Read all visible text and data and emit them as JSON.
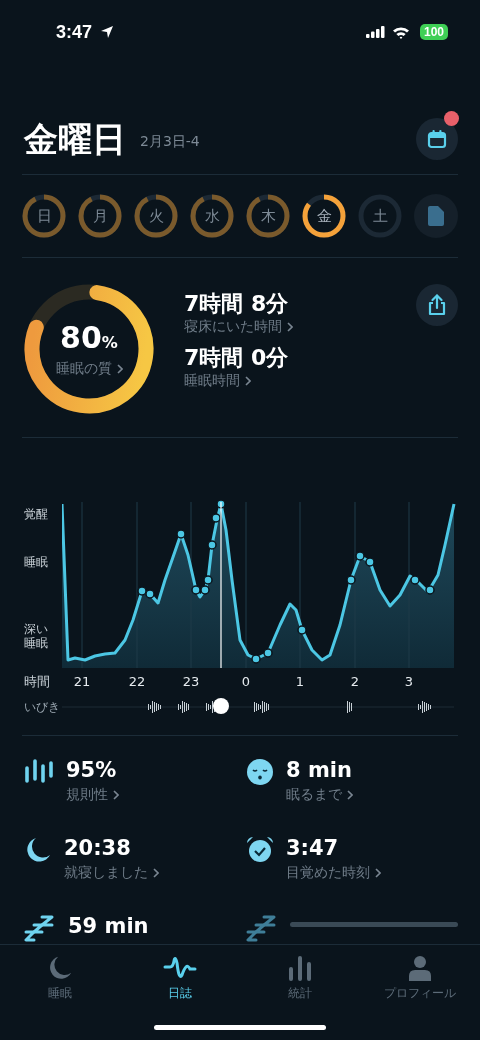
{
  "status_bar": {
    "time": "3:47",
    "battery": "100"
  },
  "header": {
    "title": "金曜日",
    "subtitle": "2月3日-4",
    "calendar_badge": true
  },
  "days": [
    {
      "label": "日",
      "recorded": true,
      "selected": false
    },
    {
      "label": "月",
      "recorded": true,
      "selected": false
    },
    {
      "label": "火",
      "recorded": true,
      "selected": false
    },
    {
      "label": "水",
      "recorded": true,
      "selected": false
    },
    {
      "label": "木",
      "recorded": true,
      "selected": false
    },
    {
      "label": "金",
      "recorded": true,
      "selected": true
    },
    {
      "label": "土",
      "recorded": false,
      "selected": false
    }
  ],
  "summary": {
    "quality": {
      "value": "80",
      "unit": "%",
      "label": "睡眠の質"
    },
    "metrics": [
      {
        "value": "7時間 8分",
        "label": "寝床にいた時間"
      },
      {
        "value": "7時間 0分",
        "label": "睡眠時間"
      }
    ]
  },
  "graph": {
    "y_labels": [
      "覚醒",
      "睡眠",
      "深い睡眠"
    ],
    "x_title": "時間",
    "hours": [
      "21",
      "22",
      "23",
      "0",
      "1",
      "2",
      "3"
    ],
    "snore_label": "いびき"
  },
  "stats": [
    {
      "kind": "bars",
      "value": "95%",
      "label": "規則性"
    },
    {
      "kind": "face",
      "value": "8 min",
      "label": "眠るまで"
    },
    {
      "kind": "moon",
      "value": "20:38",
      "label": "就寝しました"
    },
    {
      "kind": "alarm",
      "value": "3:47",
      "label": "目覚めた時刻"
    },
    {
      "kind": "zzz",
      "value": "59 min"
    },
    {
      "kind": "loading"
    }
  ],
  "tabs": [
    {
      "kind": "moon",
      "label": "睡眠",
      "selected": false
    },
    {
      "kind": "wave",
      "label": "日誌",
      "selected": true
    },
    {
      "kind": "bars",
      "label": "統計",
      "selected": false
    },
    {
      "kind": "person",
      "label": "プロフィール",
      "selected": false
    }
  ]
}
